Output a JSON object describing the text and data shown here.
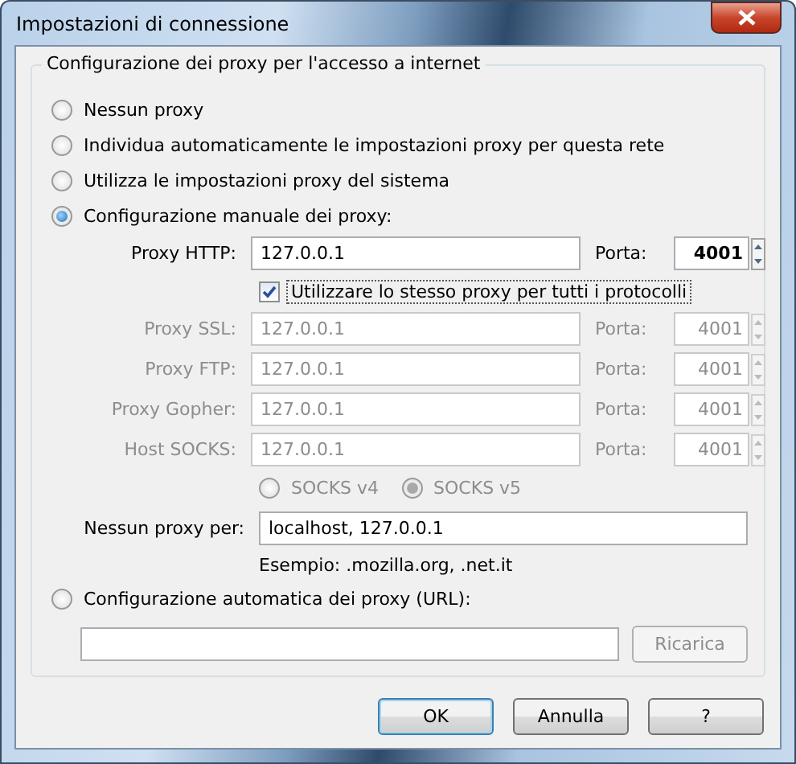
{
  "window": {
    "title": "Impostazioni di connessione"
  },
  "group": {
    "legend": "Configurazione dei proxy per l'accesso a internet"
  },
  "options": [
    {
      "label": "Nessun proxy",
      "selected": false
    },
    {
      "label": "Individua automaticamente le impostazioni proxy per questa rete",
      "selected": false
    },
    {
      "label": "Utilizza le impostazioni proxy del sistema",
      "selected": false
    },
    {
      "label": "Configurazione manuale dei proxy:",
      "selected": true
    }
  ],
  "http": {
    "label": "Proxy HTTP:",
    "value": "127.0.0.1",
    "port_label": "Porta:",
    "port": "4001",
    "disabled": false
  },
  "same_proxy": {
    "label": "Utilizzare lo stesso proxy per tutti i protocolli",
    "checked": true
  },
  "proxies": [
    {
      "label": "Proxy SSL:",
      "value": "127.0.0.1",
      "port_label": "Porta:",
      "port": "4001",
      "disabled": true
    },
    {
      "label": "Proxy FTP:",
      "value": "127.0.0.1",
      "port_label": "Porta:",
      "port": "4001",
      "disabled": true
    },
    {
      "label": "Proxy Gopher:",
      "value": "127.0.0.1",
      "port_label": "Porta:",
      "port": "4001",
      "disabled": true
    },
    {
      "label": "Host SOCKS:",
      "value": "127.0.0.1",
      "port_label": "Porta:",
      "port": "4001",
      "disabled": true
    }
  ],
  "socks": [
    {
      "label": "SOCKS v4",
      "selected": false,
      "disabled": true
    },
    {
      "label": "SOCKS v5",
      "selected": true,
      "disabled": true
    }
  ],
  "no_proxy": {
    "label": "Nessun proxy per:",
    "value": "localhost, 127.0.0.1",
    "example": "Esempio: .mozilla.org, .net.it"
  },
  "auto_config": {
    "label": "Configurazione automatica dei proxy (URL):",
    "selected": false,
    "reload": "Ricarica",
    "reload_disabled": true
  },
  "buttons": [
    {
      "label": "OK",
      "default": true
    },
    {
      "label": "Annulla",
      "default": false
    },
    {
      "label": "?",
      "default": false
    }
  ]
}
